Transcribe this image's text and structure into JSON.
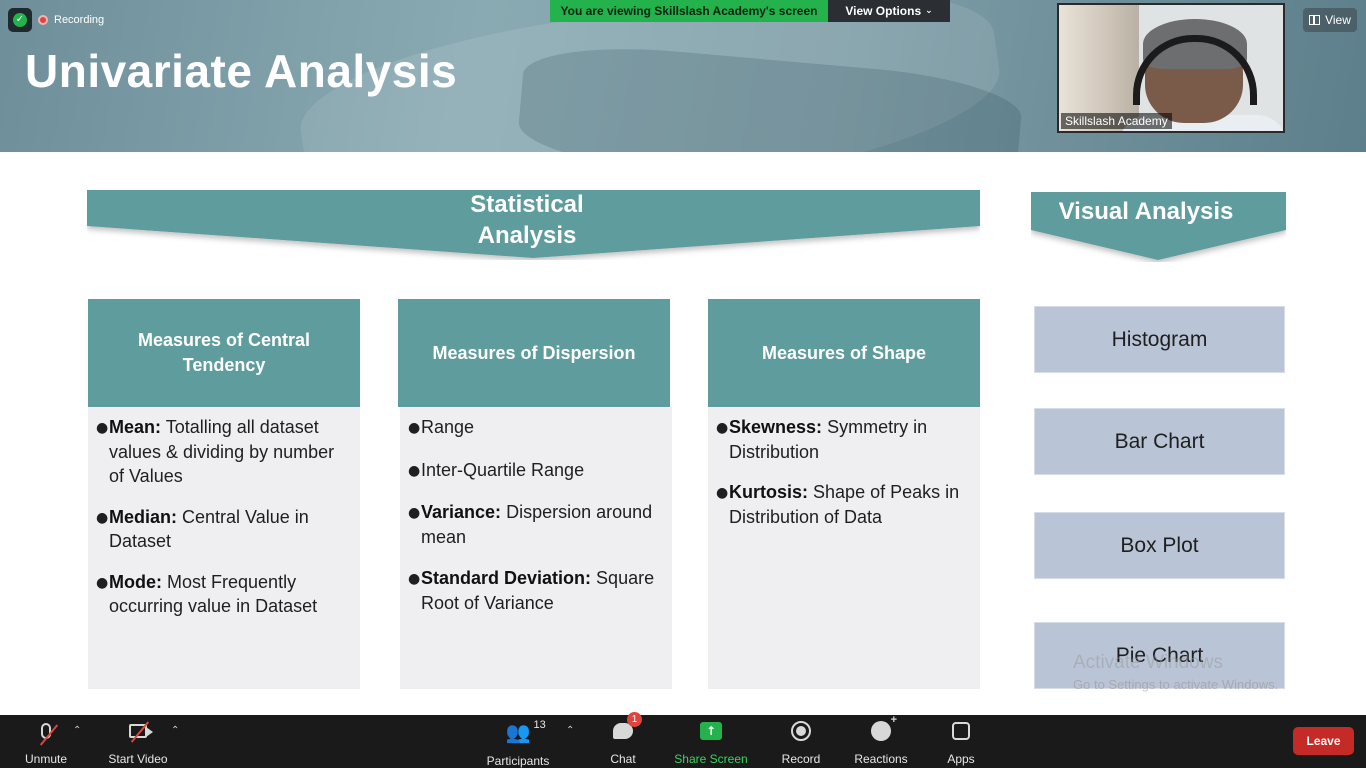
{
  "recording": {
    "label": "Recording"
  },
  "share_banner": {
    "text": "You are viewing Skillslash Academy's screen",
    "view_options": "View Options"
  },
  "video": {
    "participant_name": "Skillslash Academy"
  },
  "view_button": {
    "label": "View"
  },
  "slide": {
    "title": "Univariate Analysis",
    "statistical_banner": [
      "Statistical",
      "Analysis"
    ],
    "visual_banner": "Visual Analysis",
    "columns": [
      {
        "heading": "Measures of Central Tendency",
        "items": [
          {
            "term": "Mean:",
            "desc": "Totalling all dataset values & dividing by number of Values"
          },
          {
            "term": "Median:",
            "desc": "Central Value in Dataset"
          },
          {
            "term": "Mode:",
            "desc": "Most Frequently occurring value in Dataset"
          }
        ]
      },
      {
        "heading": "Measures of Dispersion",
        "items": [
          {
            "term": "",
            "desc": "Range"
          },
          {
            "term": "",
            "desc": "Inter-Quartile Range"
          },
          {
            "term": "Variance:",
            "desc": "Dispersion around mean"
          },
          {
            "term": "Standard Deviation:",
            "desc": "Square Root of Variance"
          }
        ]
      },
      {
        "heading": "Measures of Shape",
        "items": [
          {
            "term": "Skewness:",
            "desc": "Symmetry in Distribution"
          },
          {
            "term": "Kurtosis:",
            "desc": "Shape of Peaks in Distribution of Data"
          }
        ]
      }
    ],
    "visuals": [
      "Histogram",
      "Bar Chart",
      "Box Plot",
      "Pie Chart"
    ]
  },
  "watermark": {
    "line1": "Activate Windows",
    "line2": "Go to Settings to activate Windows."
  },
  "toolbar": {
    "unmute": "Unmute",
    "start_video": "Start Video",
    "participants": "Participants",
    "participant_count": "13",
    "chat": "Chat",
    "chat_badge": "1",
    "share_screen": "Share Screen",
    "record": "Record",
    "reactions": "Reactions",
    "apps": "Apps",
    "leave": "Leave"
  },
  "colors": {
    "teal": "#5f9c9e",
    "share_green": "#23b24b",
    "leave_red": "#c52b26",
    "visual_box": "#b9c4d6"
  },
  "icons": [
    "shield-icon",
    "record-dot-icon",
    "chevron-down-icon",
    "view-grid-icon",
    "mic-muted-icon",
    "video-off-icon",
    "participants-icon",
    "chat-icon",
    "share-screen-icon",
    "record-icon",
    "reactions-icon",
    "apps-icon"
  ]
}
